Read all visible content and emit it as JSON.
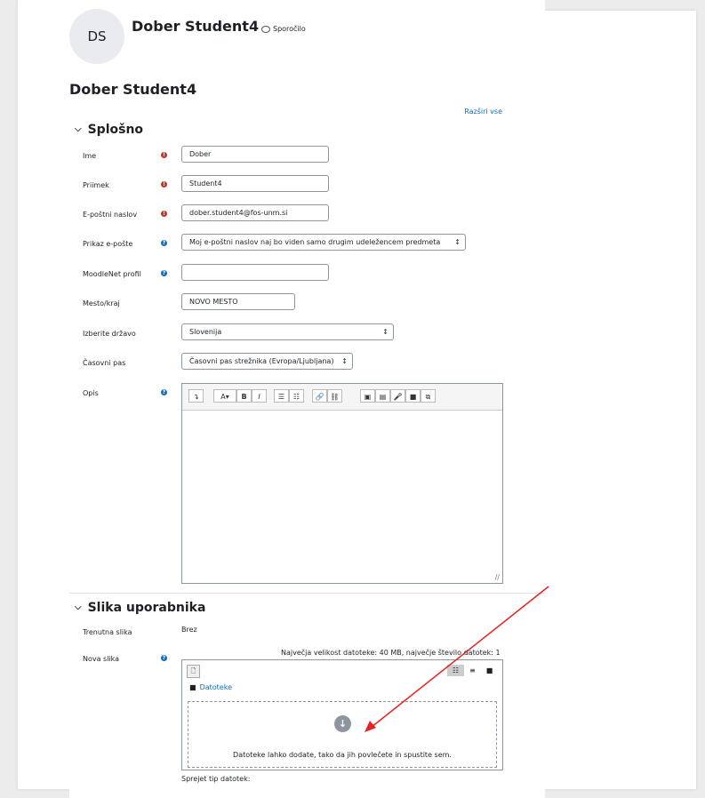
{
  "header": {
    "initials": "DS",
    "name": "Dober Student4",
    "message_link": "Sporočilo"
  },
  "page_title": "Dober Student4",
  "expand_all": "Razširi vse",
  "general": {
    "title": "Splošno",
    "fields": {
      "first_name": {
        "label": "Ime",
        "value": "Dober",
        "required": true
      },
      "last_name": {
        "label": "Priimek",
        "value": "Student4",
        "required": true
      },
      "email": {
        "label": "E-poštni naslov",
        "value": "dober.student4@fos-unm.si",
        "required": true
      },
      "email_display": {
        "label": "Prikaz e-pošte",
        "value": "Moj e-poštni naslov naj bo viden samo drugim udeležencem predmeta"
      },
      "moodlenet": {
        "label": "MoodleNet profil",
        "value": ""
      },
      "city": {
        "label": "Mesto/kraj",
        "value": "NOVO MESTO"
      },
      "country": {
        "label": "Izberite državo",
        "value": "Slovenija"
      },
      "timezone": {
        "label": "Časovni pas",
        "value": "Časovni pas strežnika (Evropa/Ljubljana)"
      },
      "description": {
        "label": "Opis"
      }
    },
    "toolbar": [
      "↴",
      "A▾",
      "B",
      "I",
      "☰",
      "☷",
      "🔗",
      "⛓",
      "▣",
      "▤",
      "🎤",
      "■",
      "⧉"
    ]
  },
  "user_picture": {
    "title": "Slika uporabnika",
    "current_label": "Trenutna slika",
    "current_value": "Brez",
    "new_label": "Nova slika",
    "limits": "Največja velikost datoteke: 40 MB, največje število datotek: 1",
    "folder_link": "Datoteke",
    "drop_text": "Datoteke lahko dodate, tako da jih povlečete in spustite sem.",
    "accepted_types": "Sprejet tip datotek:"
  },
  "colors": {
    "accent": "#0f6cbf",
    "required": "#ca3120",
    "arrow": "#e8231f"
  }
}
